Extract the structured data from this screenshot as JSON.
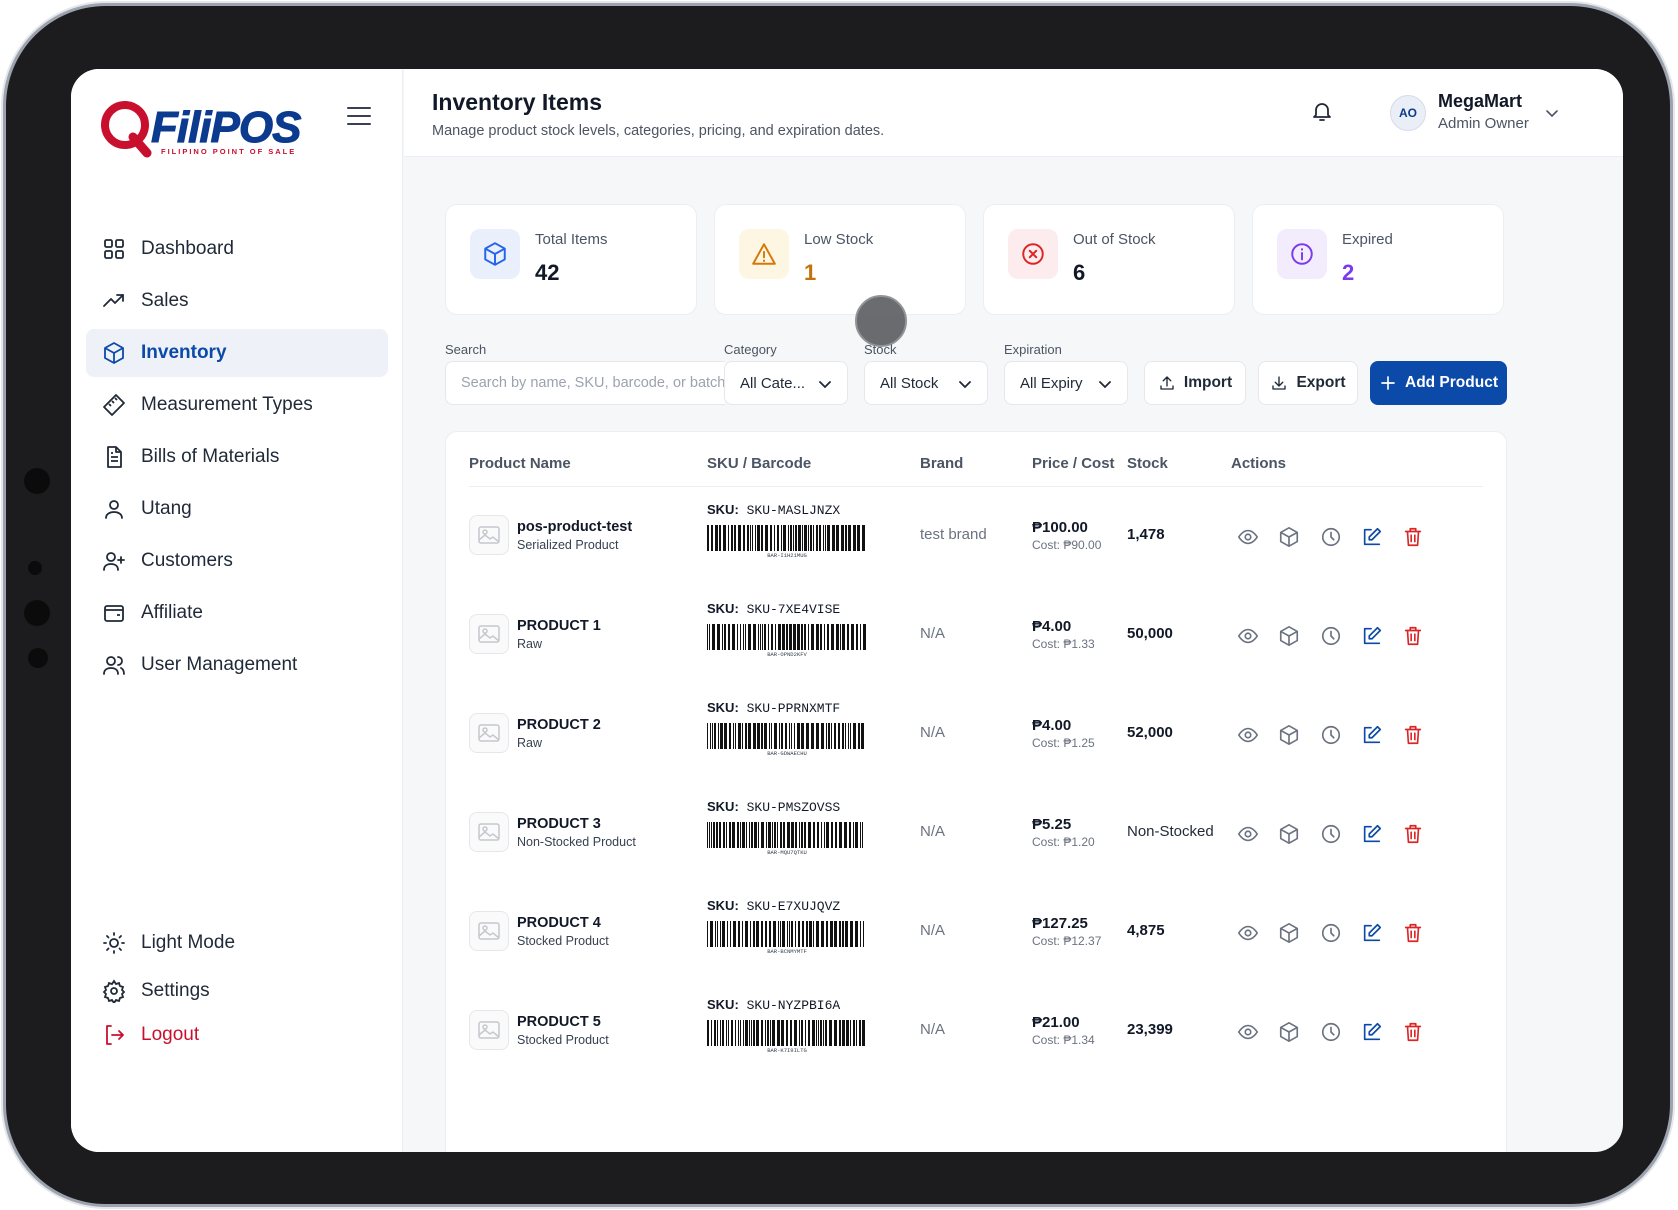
{
  "app": {
    "logo_text": "FiliPOS",
    "logo_sub": "FILIPINO POINT OF SALE"
  },
  "sidebar": {
    "items": [
      {
        "label": "Dashboard",
        "icon": "grid-icon"
      },
      {
        "label": "Sales",
        "icon": "trend-up-icon"
      },
      {
        "label": "Inventory",
        "icon": "box-icon",
        "active": true
      },
      {
        "label": "Measurement Types",
        "icon": "ruler-icon"
      },
      {
        "label": "Bills of Materials",
        "icon": "document-icon"
      },
      {
        "label": "Utang",
        "icon": "user-icon"
      },
      {
        "label": "Customers",
        "icon": "user-plus-icon"
      },
      {
        "label": "Affiliate",
        "icon": "wallet-icon"
      },
      {
        "label": "User Management",
        "icon": "users-icon"
      }
    ],
    "bottom": [
      {
        "label": "Light Mode",
        "icon": "sun-icon"
      },
      {
        "label": "Settings",
        "icon": "gear-icon"
      },
      {
        "label": "Logout",
        "icon": "logout-icon"
      }
    ]
  },
  "header": {
    "title": "Inventory Items",
    "subtitle": "Manage product stock levels, categories, pricing, and expiration dates.",
    "user_initials": "AO",
    "user_name": "MegaMart",
    "user_role": "Admin Owner"
  },
  "stats": [
    {
      "label": "Total Items",
      "value": "42",
      "color": "#111827",
      "icon": "box-icon",
      "bg": "#eaf0fb",
      "stroke": "#2563eb"
    },
    {
      "label": "Low Stock",
      "value": "1",
      "color": "#c2740b",
      "icon": "warning-icon",
      "bg": "#fdf6e3",
      "stroke": "#d97706"
    },
    {
      "label": "Out of Stock",
      "value": "6",
      "color": "#111827",
      "icon": "x-circle-icon",
      "bg": "#fdecee",
      "stroke": "#dc2626"
    },
    {
      "label": "Expired",
      "value": "2",
      "color": "#7c3aed",
      "icon": "info-icon",
      "bg": "#f2ecfd",
      "stroke": "#7c3aed"
    }
  ],
  "filters": {
    "search_label": "Search",
    "search_placeholder": "Search by name, SKU, barcode, or batch...",
    "category_label": "Category",
    "category_value": "All Cate...",
    "stock_label": "Stock",
    "stock_value": "All Stock",
    "expiration_label": "Expiration",
    "expiration_value": "All Expiry",
    "import_label": "Import",
    "export_label": "Export",
    "add_label": "Add Product"
  },
  "table": {
    "columns": [
      "Product Name",
      "SKU / Barcode",
      "Brand",
      "Price / Cost",
      "Stock",
      "Actions"
    ],
    "rows": [
      {
        "name": "pos-product-test",
        "type": "Serialized Product",
        "sku_prefix": "SKU:",
        "sku": "SKU-MASLJNZX",
        "barcode": "BAR-I1H21MUG",
        "brand": "test brand",
        "price": "₱100.00",
        "cost": "Cost: ₱90.00",
        "stock": "1,478"
      },
      {
        "name": "PRODUCT 1",
        "type": "Raw",
        "sku_prefix": "SKU:",
        "sku": "SKU-7XE4VISE",
        "barcode": "BAR-OPND2KFV",
        "brand": "N/A",
        "price": "₱4.00",
        "cost": "Cost: ₱1.33",
        "stock": "50,000"
      },
      {
        "name": "PRODUCT 2",
        "type": "Raw",
        "sku_prefix": "SKU:",
        "sku": "SKU-PPRNXMTF",
        "barcode": "BAR-GDWAECHU",
        "brand": "N/A",
        "price": "₱4.00",
        "cost": "Cost: ₱1.25",
        "stock": "52,000"
      },
      {
        "name": "PRODUCT 3",
        "type": "Non-Stocked Product",
        "sku_prefix": "SKU:",
        "sku": "SKU-PMSZOVSS",
        "barcode": "BAR-MQU7QTKU",
        "brand": "N/A",
        "price": "₱5.25",
        "cost": "Cost: ₱1.20",
        "stock": "Non-Stocked"
      },
      {
        "name": "PRODUCT 4",
        "type": "Stocked Product",
        "sku_prefix": "SKU:",
        "sku": "SKU-E7XUJQVZ",
        "barcode": "BAR-BCNMYMTF",
        "brand": "N/A",
        "price": "₱127.25",
        "cost": "Cost: ₱12.37",
        "stock": "4,875"
      },
      {
        "name": "PRODUCT 5",
        "type": "Stocked Product",
        "sku_prefix": "SKU:",
        "sku": "SKU-NYZPBI6A",
        "barcode": "BAR-K7I9ILTG",
        "brand": "N/A",
        "price": "₱21.00",
        "cost": "Cost: ₱1.34",
        "stock": "23,399"
      }
    ],
    "actions": [
      "eye-icon",
      "box-icon",
      "clock-icon",
      "edit-icon",
      "trash-icon"
    ]
  },
  "colors": {
    "primary": "#0b4aa8",
    "danger": "#c8102e",
    "icon_gray": "#6b7280"
  }
}
